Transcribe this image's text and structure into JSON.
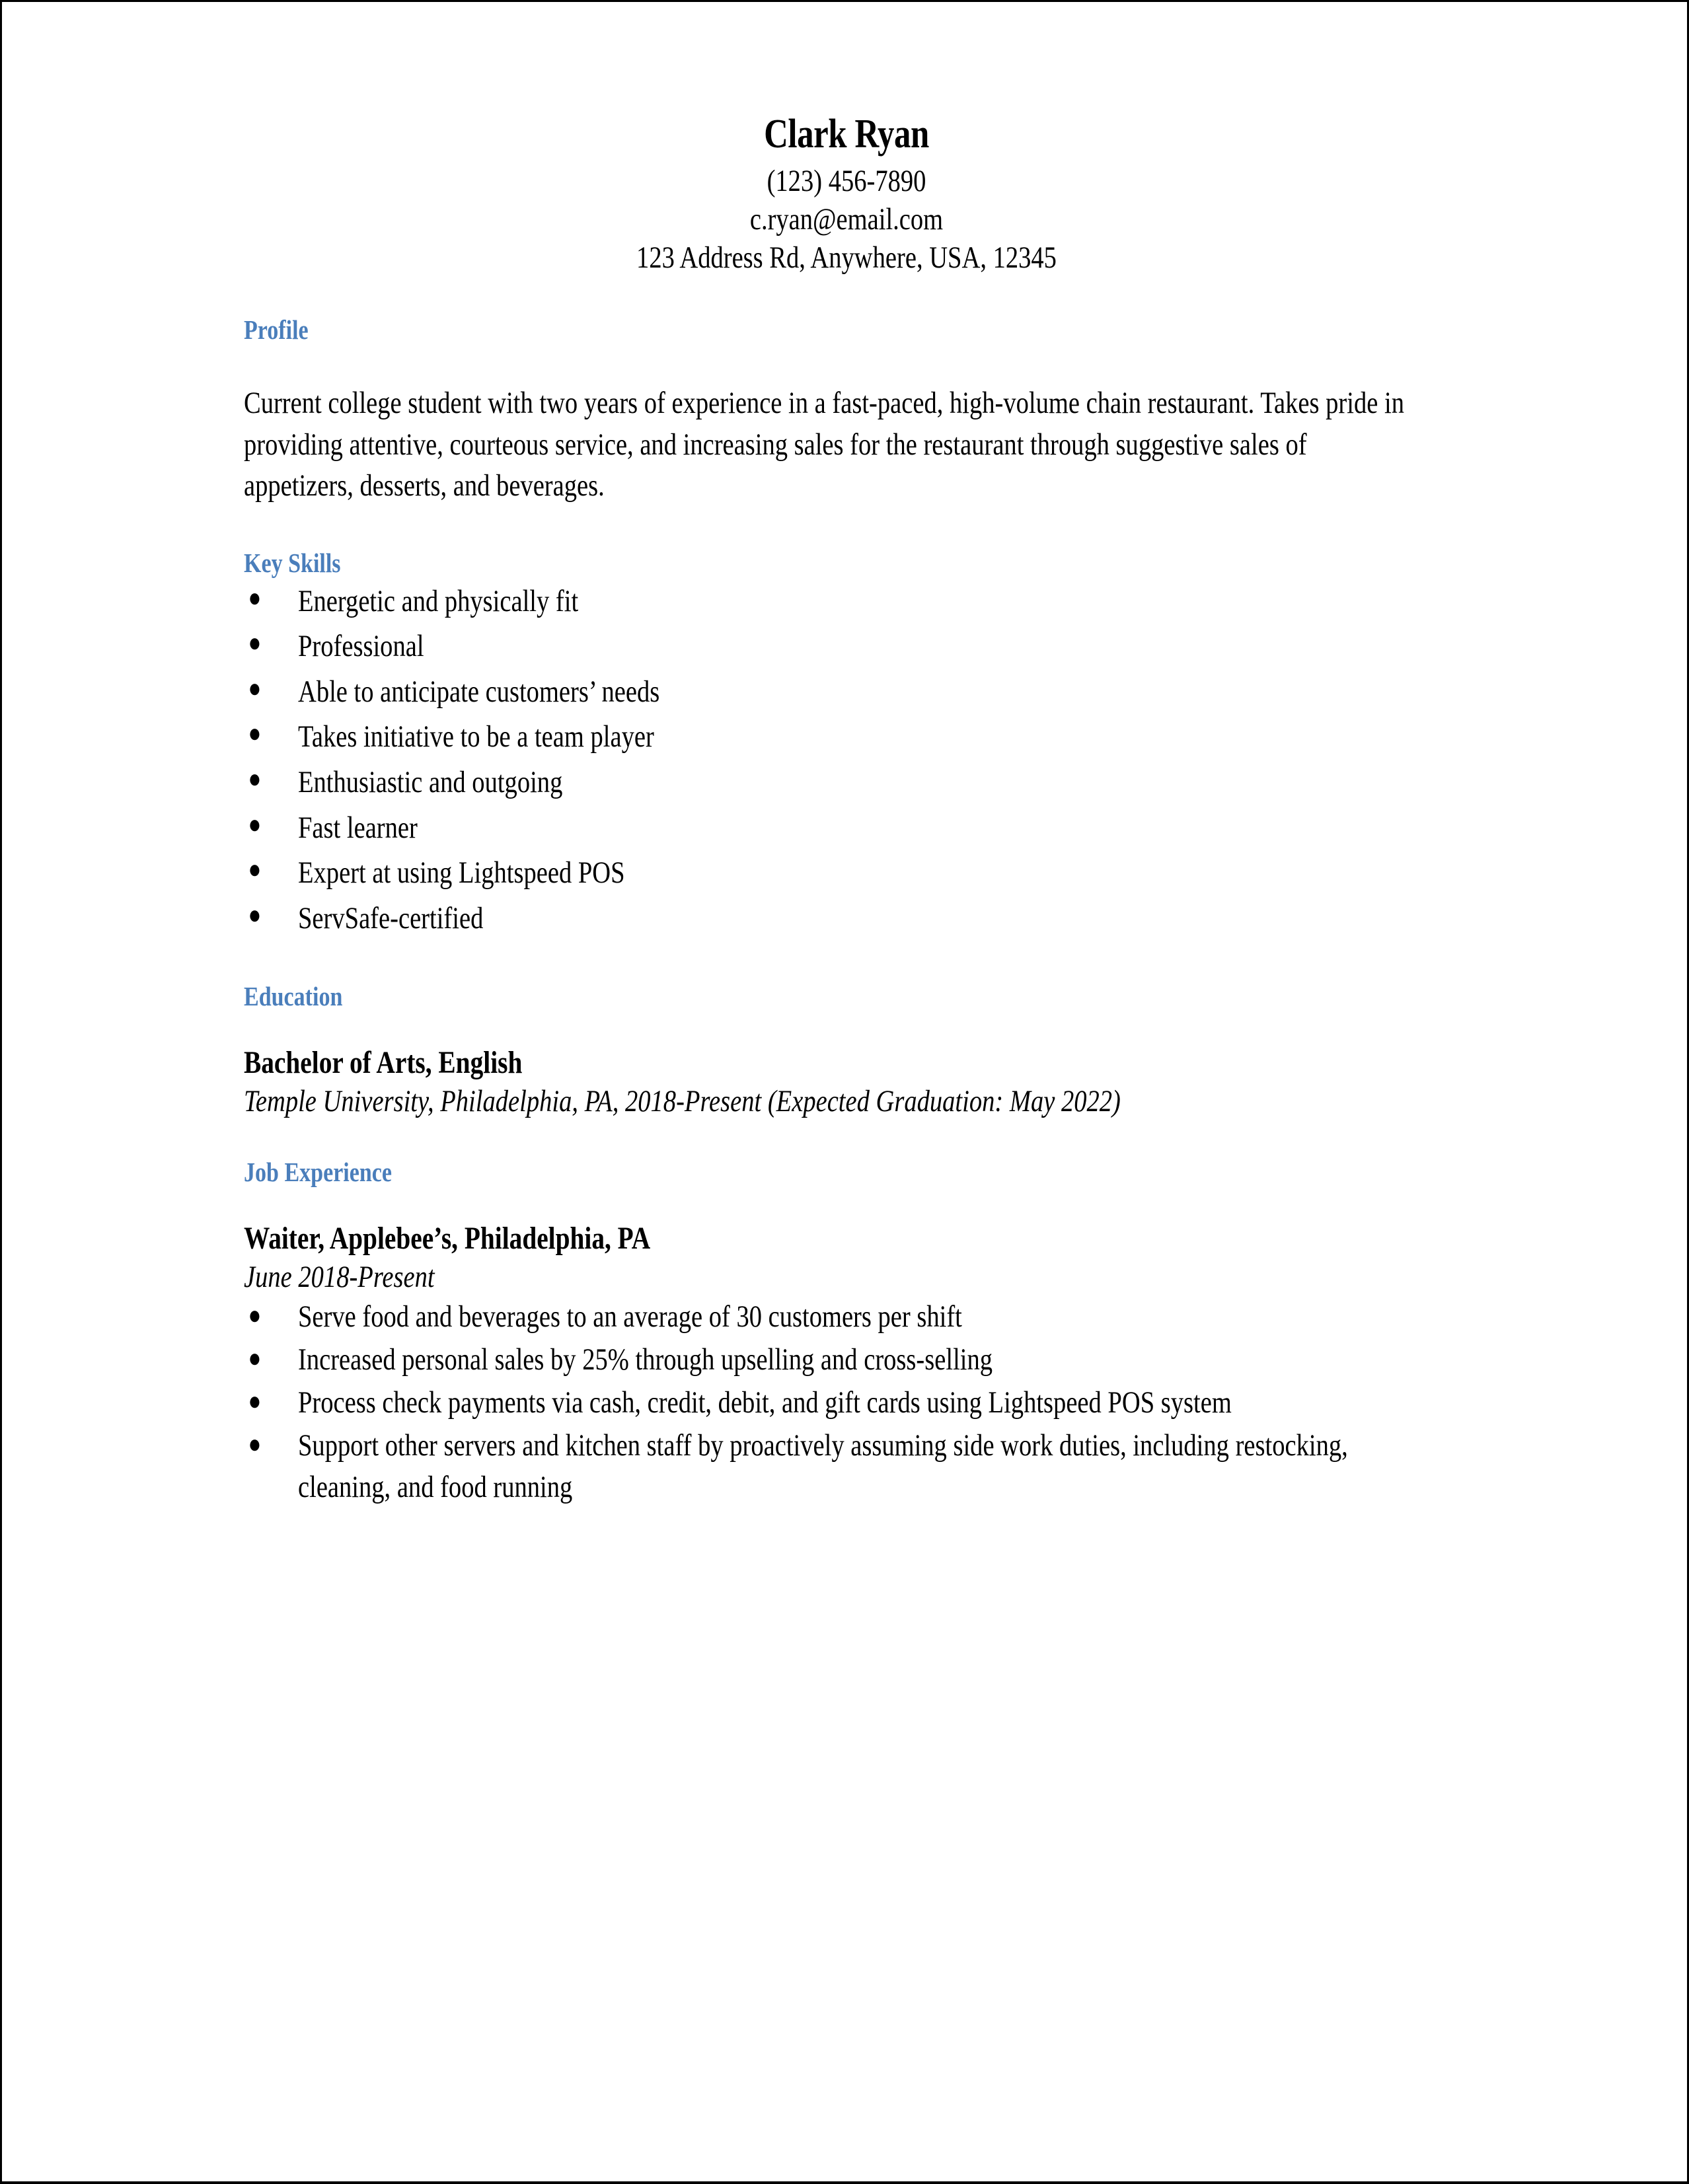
{
  "header": {
    "name": "Clark Ryan",
    "phone": "(123) 456-7890",
    "email": "c.ryan@email.com",
    "address": "123 Address Rd, Anywhere, USA, 12345"
  },
  "theme": {
    "heading_color": "#4a7ebb",
    "text_color": "#000000",
    "page_background": "#ffffff",
    "border_color": "#000000"
  },
  "sections": {
    "profile": {
      "heading": "Profile",
      "body": "Current college student with two years of experience in a fast-paced, high-volume chain restaurant. Takes pride in providing attentive, courteous service, and increasing sales for the restaurant through suggestive sales of appetizers, desserts, and beverages."
    },
    "key_skills": {
      "heading": "Key Skills",
      "items": [
        "Energetic and physically fit",
        "Professional",
        "Able to anticipate customers’ needs",
        "Takes initiative to be a team player",
        "Enthusiastic and outgoing",
        "Fast learner",
        "Expert at using Lightspeed POS",
        "ServSafe-certified"
      ]
    },
    "education": {
      "heading": "Education",
      "degree": "Bachelor of Arts, English",
      "school": "Temple University, Philadelphia, PA, 2018-Present (Expected Graduation: May 2022)"
    },
    "job_experience": {
      "heading": "Job Experience",
      "position": "Waiter, Applebee’s, Philadelphia, PA",
      "dates": "June 2018-Present",
      "items": [
        "Serve food and beverages to an average of 30 customers per shift",
        "Increased personal sales by 25% through upselling and cross-selling",
        "Process check payments via cash, credit, debit, and gift cards using Lightspeed POS system",
        "Support other servers and kitchen staff by proactively assuming side work duties, including restocking, cleaning, and food running"
      ]
    }
  },
  "bullet_glyph": "●"
}
